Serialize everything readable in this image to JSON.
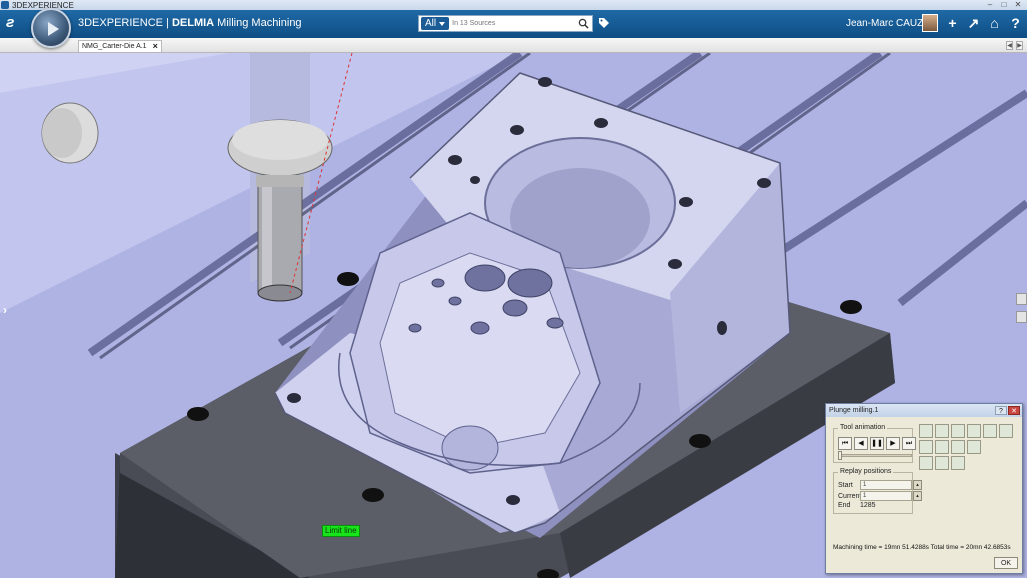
{
  "window": {
    "title": "3DEXPERIENCE"
  },
  "header": {
    "brand_prefix": "3DEXPERIENCE | ",
    "brand_strong": "DELMIA",
    "brand_app": " Milling Machining",
    "search_scope": "All",
    "search_placeholder": "In 13 Sources",
    "user_name": "Jean-Marc CAUZAC"
  },
  "tabs": [
    {
      "label": "NMG_Carter-Die A.1"
    }
  ],
  "viewport": {
    "limit_label": "Limit line",
    "colors": {
      "background": "#aeb3e4",
      "part": "#d4d5ef",
      "part_dark": "#8e90c0",
      "fixture": "#4a4c55",
      "table": "#5a5e8e"
    }
  },
  "dialog": {
    "title": "Plunge milling.1",
    "tool_animation_label": "Tool animation",
    "anim_buttons": [
      "⏮",
      "◀",
      "❚❚",
      "▶",
      "⏭"
    ],
    "replay_label": "Replay positions",
    "start_label": "Start",
    "start_value": "1",
    "current_label": "Current",
    "current_value": "1",
    "end_label": "End",
    "end_value": "1285",
    "times_text": "Machining time = 19mn 51.4288s   Total time = 20mn 42.6853s",
    "ok_label": "OK"
  }
}
